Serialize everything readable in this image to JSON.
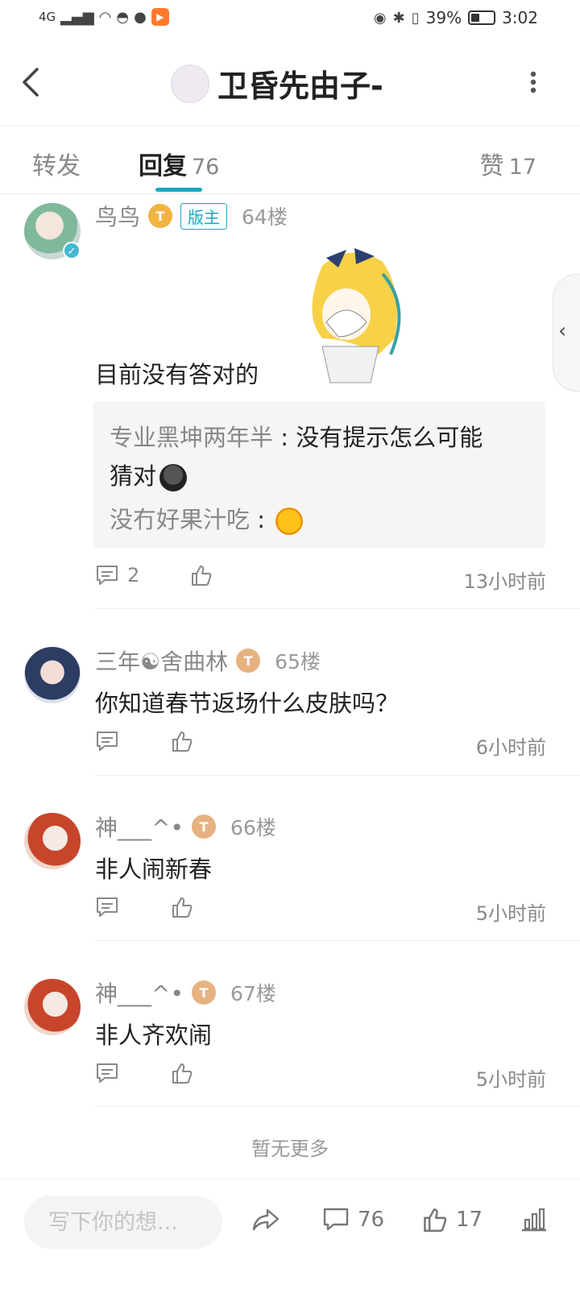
{
  "status_bar": {
    "network": "4G",
    "battery": "39%",
    "time": "3:02"
  },
  "header": {
    "title": "卫昏先由子-"
  },
  "tabs": {
    "forward_label": "转发",
    "reply_label": "回复",
    "reply_count": "76",
    "like_label": "赞",
    "like_count": "17"
  },
  "comments": [
    {
      "username": "鸟鸟",
      "level": "T",
      "badge": "版主",
      "floor": "64楼",
      "text": "目前没有答对的",
      "subreplies": [
        {
          "name": "专业黑坤两年半",
          "sep": " : ",
          "text": "没有提示怎么可能",
          "text2": "猜对"
        },
        {
          "name": "没冇好果汁吃",
          "sep": " : ",
          "text": ""
        }
      ],
      "reply_count": "2",
      "time": "13小时前"
    },
    {
      "username": "三年☯舍曲林",
      "level": "T",
      "floor": "65楼",
      "text": "你知道春节返场什么皮肤吗？",
      "time": "6小时前"
    },
    {
      "username": "神___^•",
      "level": "T",
      "floor": "66楼",
      "text": "非人闹新春",
      "time": "5小时前"
    },
    {
      "username": "神___^•",
      "level": "T",
      "floor": "67楼",
      "text": "非人齐欢闹",
      "time": "5小时前"
    }
  ],
  "no_more": "暂无更多",
  "bottom_bar": {
    "input_placeholder": "写下你的想...",
    "comment_count": "76",
    "like_count": "17"
  },
  "colors": {
    "accent": "#1aa7c2",
    "level_gold": "#f2b441",
    "level_bronze": "#e7b281"
  }
}
